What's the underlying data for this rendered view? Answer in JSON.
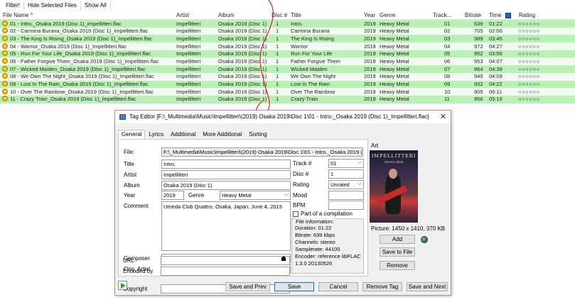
{
  "toolbar": {
    "filter": "Filter!",
    "hide_selected": "Hide Selected Files",
    "show_all": "Show All"
  },
  "columns": {
    "file_name": "File Name ^",
    "artist": "Artist",
    "album": "Album",
    "disc": "Disc #",
    "title": "Title",
    "year": "Year",
    "genre": "Genre",
    "track": "Track...",
    "bitrate": "Bitrate",
    "time": "Time",
    "rating": "Rating"
  },
  "rows": [
    {
      "file": "01 - Intro._Osaka 2019 (Disc 1)_Impellitteri.flac",
      "artist": "Impellitteri",
      "album": "Osaka 2019 (Disc 1)",
      "disc": "1",
      "title": "Intro.",
      "year": "2019",
      "genre": "Heavy Metal",
      "track": "01",
      "bitrate": "639",
      "time": "01:22",
      "rating": "○○○○○○"
    },
    {
      "file": "02 - Carmina Burana_Osaka 2019 (Disc 1)_Impellitteri.flac",
      "artist": "Impellitteri",
      "album": "Osaka 2019 (Disc 1)",
      "disc": "1",
      "title": "Carmina Burana",
      "year": "2019",
      "genre": "Heavy Metal",
      "track": "02",
      "bitrate": "705",
      "time": "02:00",
      "rating": "○○○○○○"
    },
    {
      "file": "03 - The King Is Rising_Osaka 2019 (Disc 1)_Impellitteri.flac",
      "artist": "Impellitteri",
      "album": "Osaka 2019 (Disc 1)",
      "disc": "1",
      "title": "The King Is Rising",
      "year": "2019",
      "genre": "Heavy Metal",
      "track": "03",
      "bitrate": "989",
      "time": "03:45",
      "rating": "○○○○○○"
    },
    {
      "file": "04 - Warrior_Osaka 2019 (Disc 1)_Impellitteri.flac",
      "artist": "Impellitteri",
      "album": "Osaka 2019 (Disc 1)",
      "disc": "1",
      "title": "Warrior",
      "year": "2019",
      "genre": "Heavy Metal",
      "track": "04",
      "bitrate": "972",
      "time": "04:27",
      "rating": "○○○○○○"
    },
    {
      "file": "05 - Run For Your Life_Osaka 2019 (Disc 1)_Impellitteri.flac",
      "artist": "Impellitteri",
      "album": "Osaka 2019 (Disc 1)",
      "disc": "1",
      "title": "Run For Your Life",
      "year": "2019",
      "genre": "Heavy Metal",
      "track": "05",
      "bitrate": "952",
      "time": "03:56",
      "rating": "○○○○○○"
    },
    {
      "file": "06 - Father Forgive Them_Osaka 2019 (Disc 1)_Impellitteri.flac",
      "artist": "Impellitteri",
      "album": "Osaka 2019 (Disc 1)",
      "disc": "1",
      "title": "Father Forgive Them",
      "year": "2019",
      "genre": "Heavy Metal",
      "track": "06",
      "bitrate": "953",
      "time": "04:07",
      "rating": "○○○○○○"
    },
    {
      "file": "07 - Wicked Maiden_Osaka 2019 (Disc 1)_Impellitteri.flac",
      "artist": "Impellitteri",
      "album": "Osaka 2019 (Disc 1)",
      "disc": "1",
      "title": "Wicked Maiden",
      "year": "2019",
      "genre": "Heavy Metal",
      "track": "07",
      "bitrate": "964",
      "time": "04:39",
      "rating": "○○○○○○"
    },
    {
      "file": "08 - We Own The Night_Osaka 2019 (Disc 1)_Impellitteri.flac",
      "artist": "Impellitteri",
      "album": "Osaka 2019 (Disc 1)",
      "disc": "1",
      "title": "We Own The Night",
      "year": "2019",
      "genre": "Heavy Metal",
      "track": "08",
      "bitrate": "940",
      "time": "04:09",
      "rating": "○○○○○○"
    },
    {
      "file": "09 - Lost In The Rain_Osaka 2019 (Disc 1)_Impellitteri.flac",
      "artist": "Impellitteri",
      "album": "Osaka 2019 (Disc 1)",
      "disc": "1",
      "title": "Lost In The Rain",
      "year": "2019",
      "genre": "Heavy Metal",
      "track": "09",
      "bitrate": "932",
      "time": "04:22",
      "rating": "○○○○○○"
    },
    {
      "file": "10 - Over The Rainbow_Osaka 2019 (Disc 1)_Impellitteri.flac",
      "artist": "Impellitteri",
      "album": "Osaka 2019 (Disc 1)",
      "disc": "1",
      "title": "Over The Rainbow",
      "year": "2019",
      "genre": "Heavy Metal",
      "track": "10",
      "bitrate": "905",
      "time": "06:11",
      "rating": "○○○○○○"
    },
    {
      "file": "11 - Crazy Train_Osaka 2019 (Disc 1)_Impellitteri.flac",
      "artist": "Impellitteri",
      "album": "Osaka 2019 (Disc 1)",
      "disc": "1",
      "title": "Crazy Train",
      "year": "2019",
      "genre": "Heavy Metal",
      "track": "11",
      "bitrate": "956",
      "time": "05:16",
      "rating": "○○○○○○"
    }
  ],
  "dialog": {
    "title": "Tag Editor [F:\\_Multimedia\\Music\\Impellitteri\\(2019) Osaka 2019\\Disc 1\\01 - Intro._Osaka 2019 (Disc 1)_Impellitteri.flac]",
    "close": "✕",
    "tabs": [
      "General",
      "Lyrics",
      "Additional",
      "More Additional",
      "Sorting"
    ],
    "labels": {
      "file": "File:",
      "title": "Title",
      "artist": "Artist",
      "album": "Album",
      "year": "Year",
      "genre": "Genre",
      "comment": "Comment",
      "composer": "Composer",
      "orig_artist": "Orig. Artist",
      "copyright": "Copyright",
      "url": "URL",
      "encoded_by": "Encoded by",
      "track": "Track #",
      "disc": "Disc #",
      "rating": "Rating",
      "mood": "Mood",
      "bpm": "BPM",
      "compilation": "Part of a compilation",
      "art": "Art"
    },
    "values": {
      "file": "F:\\_Multimedia\\Music\\Impellitteri\\(2019) Osaka 2019\\Disc 1\\01 - Intro._Osaka 2019 (Disc 1)_Impellitteri.flac",
      "title": "Intro.",
      "artist": "Impellitteri",
      "album": "Osaka 2019 (Disc 1)",
      "year": "2019",
      "genre": "Heavy Metal",
      "comment": "Umeda Club Quattro, Osaka, Japan, June 4, 2019",
      "track": "01",
      "disc": "1",
      "rating": "Unrated"
    },
    "file_info": {
      "heading": "File information:",
      "duration": "Duration: 01:22",
      "bitrate": "Bitrate: 639 kbps",
      "channels": "Channels: stereo",
      "samplerate": "Samplerate: 44100",
      "encoder": "Encoder: reference libFLAC",
      "encoder2": "1.3.0 20130526"
    },
    "art": {
      "band": "IMPELLITTERI",
      "sub": "OSAKA 2019",
      "picture_info": "Picture: 1450 x 1410, 370 KB"
    },
    "buttons": {
      "add": "Add",
      "save_to_file": "Save to File",
      "remove": "Remove",
      "save_and_prev": "Save and Prev",
      "save": "Save",
      "cancel": "Cancel",
      "remove_tag": "Remove Tag",
      "save_and_next": "Save and Next"
    }
  }
}
